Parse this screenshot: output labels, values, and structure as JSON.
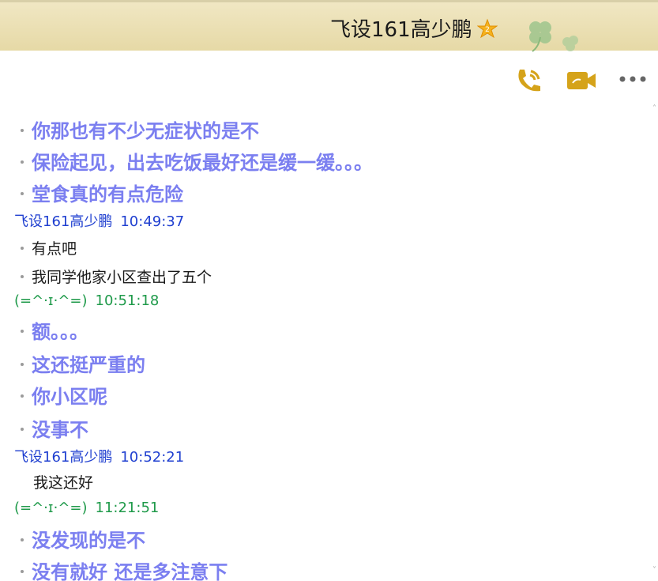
{
  "title": {
    "name": "飞设161高少鹏",
    "badge_icon": "gold-star-badge-icon",
    "decoration": "four-leaf-clover"
  },
  "toolbar": {
    "phone_icon": "phone-call-icon",
    "video_icon": "video-camera-icon",
    "more_icon": "more-options-icon"
  },
  "colors": {
    "titlebar": "#e9dcaa",
    "my_message": "#7b7ff0",
    "other_name": "#1f3fd0",
    "my_name": "#1f9a4a"
  },
  "messages": {
    "g1": {
      "m1": "你那也有不少无症状的是不",
      "m2": "保险起见，出去吃饭最好还是缓一缓。。。",
      "m3": "堂食真的有点危险"
    },
    "h2": {
      "sender": "飞设161高少鹏",
      "time": "10:49:37"
    },
    "g2": {
      "m1": "有点吧",
      "m2": "我同学他家小区查出了五个"
    },
    "h3": {
      "sender": "(=^·ɪ·^=)",
      "time": "10:51:18"
    },
    "g3": {
      "m1": "额。。。",
      "m2": "这还挺严重的",
      "m3": "你小区呢",
      "m4": "没事不"
    },
    "h4": {
      "sender": "飞设161高少鹏",
      "time": "10:52:21"
    },
    "g4": {
      "m1": "我这还好"
    },
    "h5": {
      "sender": "(=^·ɪ·^=)",
      "time": "11:21:51"
    },
    "g5": {
      "m1": "没发现的是不",
      "m2": "没有就好 还是多注意下"
    }
  }
}
